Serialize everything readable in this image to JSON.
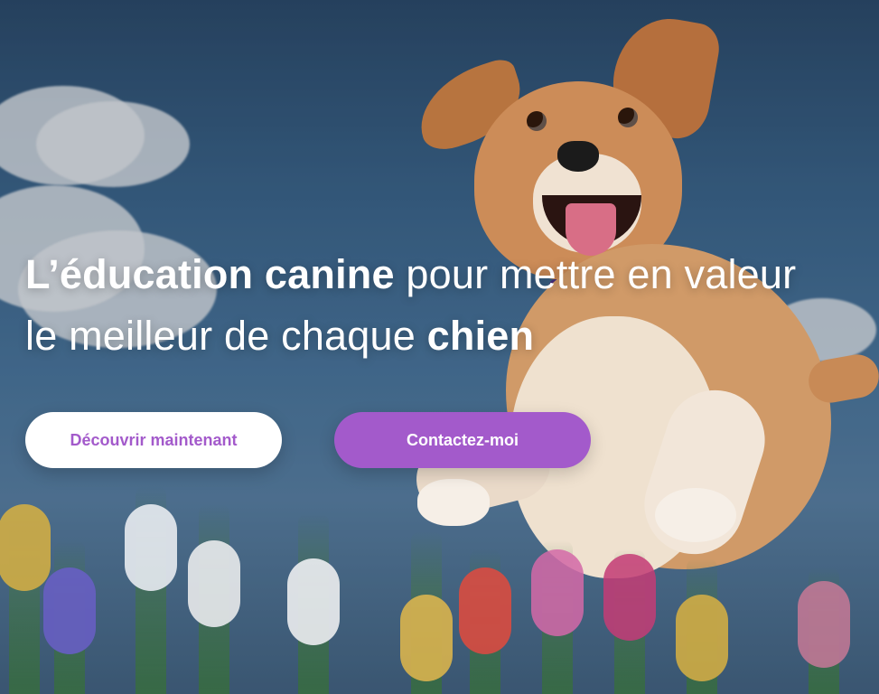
{
  "hero": {
    "headline": {
      "line1_strong": "L’éducation canine",
      "line1_rest": " pour mettre en valeur",
      "line2_lead": "le meilleur de chaque ",
      "line2_strong": "chien"
    },
    "buttons": {
      "discover": "Découvrir maintenant",
      "contact": "Contactez-moi"
    },
    "colors": {
      "accent": "#a35acb",
      "sky_top": "#2e4f72",
      "sky_bottom": "#5d86ac",
      "button_white": "#ffffff"
    }
  }
}
